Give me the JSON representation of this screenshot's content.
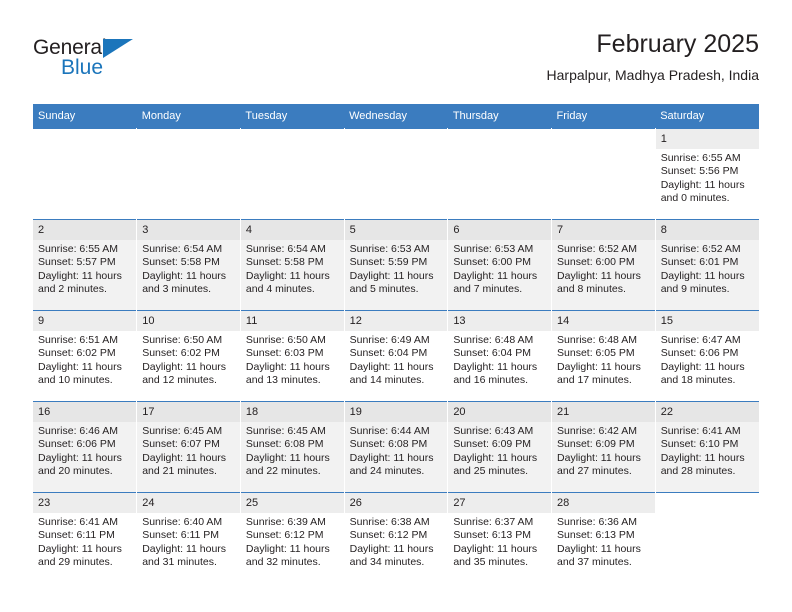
{
  "brand": {
    "name_part1": "General",
    "name_part2": "Blue",
    "triangle_icon": "triangle-icon",
    "accent_color": "#1b75bb"
  },
  "header": {
    "title": "February 2025",
    "subtitle": "Harpalpur, Madhya Pradesh, India"
  },
  "calendar": {
    "header_color": "#3b7cbf",
    "weekdays": [
      "Sunday",
      "Monday",
      "Tuesday",
      "Wednesday",
      "Thursday",
      "Friday",
      "Saturday"
    ],
    "weeks": [
      [
        {
          "day": "",
          "sunrise": "",
          "sunset": "",
          "daylight": "",
          "daylight2": ""
        },
        {
          "day": "",
          "sunrise": "",
          "sunset": "",
          "daylight": "",
          "daylight2": ""
        },
        {
          "day": "",
          "sunrise": "",
          "sunset": "",
          "daylight": "",
          "daylight2": ""
        },
        {
          "day": "",
          "sunrise": "",
          "sunset": "",
          "daylight": "",
          "daylight2": ""
        },
        {
          "day": "",
          "sunrise": "",
          "sunset": "",
          "daylight": "",
          "daylight2": ""
        },
        {
          "day": "",
          "sunrise": "",
          "sunset": "",
          "daylight": "",
          "daylight2": ""
        },
        {
          "day": "1",
          "sunrise": "Sunrise: 6:55 AM",
          "sunset": "Sunset: 5:56 PM",
          "daylight": "Daylight: 11 hours",
          "daylight2": "and 0 minutes."
        }
      ],
      [
        {
          "day": "2",
          "sunrise": "Sunrise: 6:55 AM",
          "sunset": "Sunset: 5:57 PM",
          "daylight": "Daylight: 11 hours",
          "daylight2": "and 2 minutes."
        },
        {
          "day": "3",
          "sunrise": "Sunrise: 6:54 AM",
          "sunset": "Sunset: 5:58 PM",
          "daylight": "Daylight: 11 hours",
          "daylight2": "and 3 minutes."
        },
        {
          "day": "4",
          "sunrise": "Sunrise: 6:54 AM",
          "sunset": "Sunset: 5:58 PM",
          "daylight": "Daylight: 11 hours",
          "daylight2": "and 4 minutes."
        },
        {
          "day": "5",
          "sunrise": "Sunrise: 6:53 AM",
          "sunset": "Sunset: 5:59 PM",
          "daylight": "Daylight: 11 hours",
          "daylight2": "and 5 minutes."
        },
        {
          "day": "6",
          "sunrise": "Sunrise: 6:53 AM",
          "sunset": "Sunset: 6:00 PM",
          "daylight": "Daylight: 11 hours",
          "daylight2": "and 7 minutes."
        },
        {
          "day": "7",
          "sunrise": "Sunrise: 6:52 AM",
          "sunset": "Sunset: 6:00 PM",
          "daylight": "Daylight: 11 hours",
          "daylight2": "and 8 minutes."
        },
        {
          "day": "8",
          "sunrise": "Sunrise: 6:52 AM",
          "sunset": "Sunset: 6:01 PM",
          "daylight": "Daylight: 11 hours",
          "daylight2": "and 9 minutes."
        }
      ],
      [
        {
          "day": "9",
          "sunrise": "Sunrise: 6:51 AM",
          "sunset": "Sunset: 6:02 PM",
          "daylight": "Daylight: 11 hours",
          "daylight2": "and 10 minutes."
        },
        {
          "day": "10",
          "sunrise": "Sunrise: 6:50 AM",
          "sunset": "Sunset: 6:02 PM",
          "daylight": "Daylight: 11 hours",
          "daylight2": "and 12 minutes."
        },
        {
          "day": "11",
          "sunrise": "Sunrise: 6:50 AM",
          "sunset": "Sunset: 6:03 PM",
          "daylight": "Daylight: 11 hours",
          "daylight2": "and 13 minutes."
        },
        {
          "day": "12",
          "sunrise": "Sunrise: 6:49 AM",
          "sunset": "Sunset: 6:04 PM",
          "daylight": "Daylight: 11 hours",
          "daylight2": "and 14 minutes."
        },
        {
          "day": "13",
          "sunrise": "Sunrise: 6:48 AM",
          "sunset": "Sunset: 6:04 PM",
          "daylight": "Daylight: 11 hours",
          "daylight2": "and 16 minutes."
        },
        {
          "day": "14",
          "sunrise": "Sunrise: 6:48 AM",
          "sunset": "Sunset: 6:05 PM",
          "daylight": "Daylight: 11 hours",
          "daylight2": "and 17 minutes."
        },
        {
          "day": "15",
          "sunrise": "Sunrise: 6:47 AM",
          "sunset": "Sunset: 6:06 PM",
          "daylight": "Daylight: 11 hours",
          "daylight2": "and 18 minutes."
        }
      ],
      [
        {
          "day": "16",
          "sunrise": "Sunrise: 6:46 AM",
          "sunset": "Sunset: 6:06 PM",
          "daylight": "Daylight: 11 hours",
          "daylight2": "and 20 minutes."
        },
        {
          "day": "17",
          "sunrise": "Sunrise: 6:45 AM",
          "sunset": "Sunset: 6:07 PM",
          "daylight": "Daylight: 11 hours",
          "daylight2": "and 21 minutes."
        },
        {
          "day": "18",
          "sunrise": "Sunrise: 6:45 AM",
          "sunset": "Sunset: 6:08 PM",
          "daylight": "Daylight: 11 hours",
          "daylight2": "and 22 minutes."
        },
        {
          "day": "19",
          "sunrise": "Sunrise: 6:44 AM",
          "sunset": "Sunset: 6:08 PM",
          "daylight": "Daylight: 11 hours",
          "daylight2": "and 24 minutes."
        },
        {
          "day": "20",
          "sunrise": "Sunrise: 6:43 AM",
          "sunset": "Sunset: 6:09 PM",
          "daylight": "Daylight: 11 hours",
          "daylight2": "and 25 minutes."
        },
        {
          "day": "21",
          "sunrise": "Sunrise: 6:42 AM",
          "sunset": "Sunset: 6:09 PM",
          "daylight": "Daylight: 11 hours",
          "daylight2": "and 27 minutes."
        },
        {
          "day": "22",
          "sunrise": "Sunrise: 6:41 AM",
          "sunset": "Sunset: 6:10 PM",
          "daylight": "Daylight: 11 hours",
          "daylight2": "and 28 minutes."
        }
      ],
      [
        {
          "day": "23",
          "sunrise": "Sunrise: 6:41 AM",
          "sunset": "Sunset: 6:11 PM",
          "daylight": "Daylight: 11 hours",
          "daylight2": "and 29 minutes."
        },
        {
          "day": "24",
          "sunrise": "Sunrise: 6:40 AM",
          "sunset": "Sunset: 6:11 PM",
          "daylight": "Daylight: 11 hours",
          "daylight2": "and 31 minutes."
        },
        {
          "day": "25",
          "sunrise": "Sunrise: 6:39 AM",
          "sunset": "Sunset: 6:12 PM",
          "daylight": "Daylight: 11 hours",
          "daylight2": "and 32 minutes."
        },
        {
          "day": "26",
          "sunrise": "Sunrise: 6:38 AM",
          "sunset": "Sunset: 6:12 PM",
          "daylight": "Daylight: 11 hours",
          "daylight2": "and 34 minutes."
        },
        {
          "day": "27",
          "sunrise": "Sunrise: 6:37 AM",
          "sunset": "Sunset: 6:13 PM",
          "daylight": "Daylight: 11 hours",
          "daylight2": "and 35 minutes."
        },
        {
          "day": "28",
          "sunrise": "Sunrise: 6:36 AM",
          "sunset": "Sunset: 6:13 PM",
          "daylight": "Daylight: 11 hours",
          "daylight2": "and 37 minutes."
        },
        {
          "day": "",
          "sunrise": "",
          "sunset": "",
          "daylight": "",
          "daylight2": ""
        }
      ]
    ]
  }
}
